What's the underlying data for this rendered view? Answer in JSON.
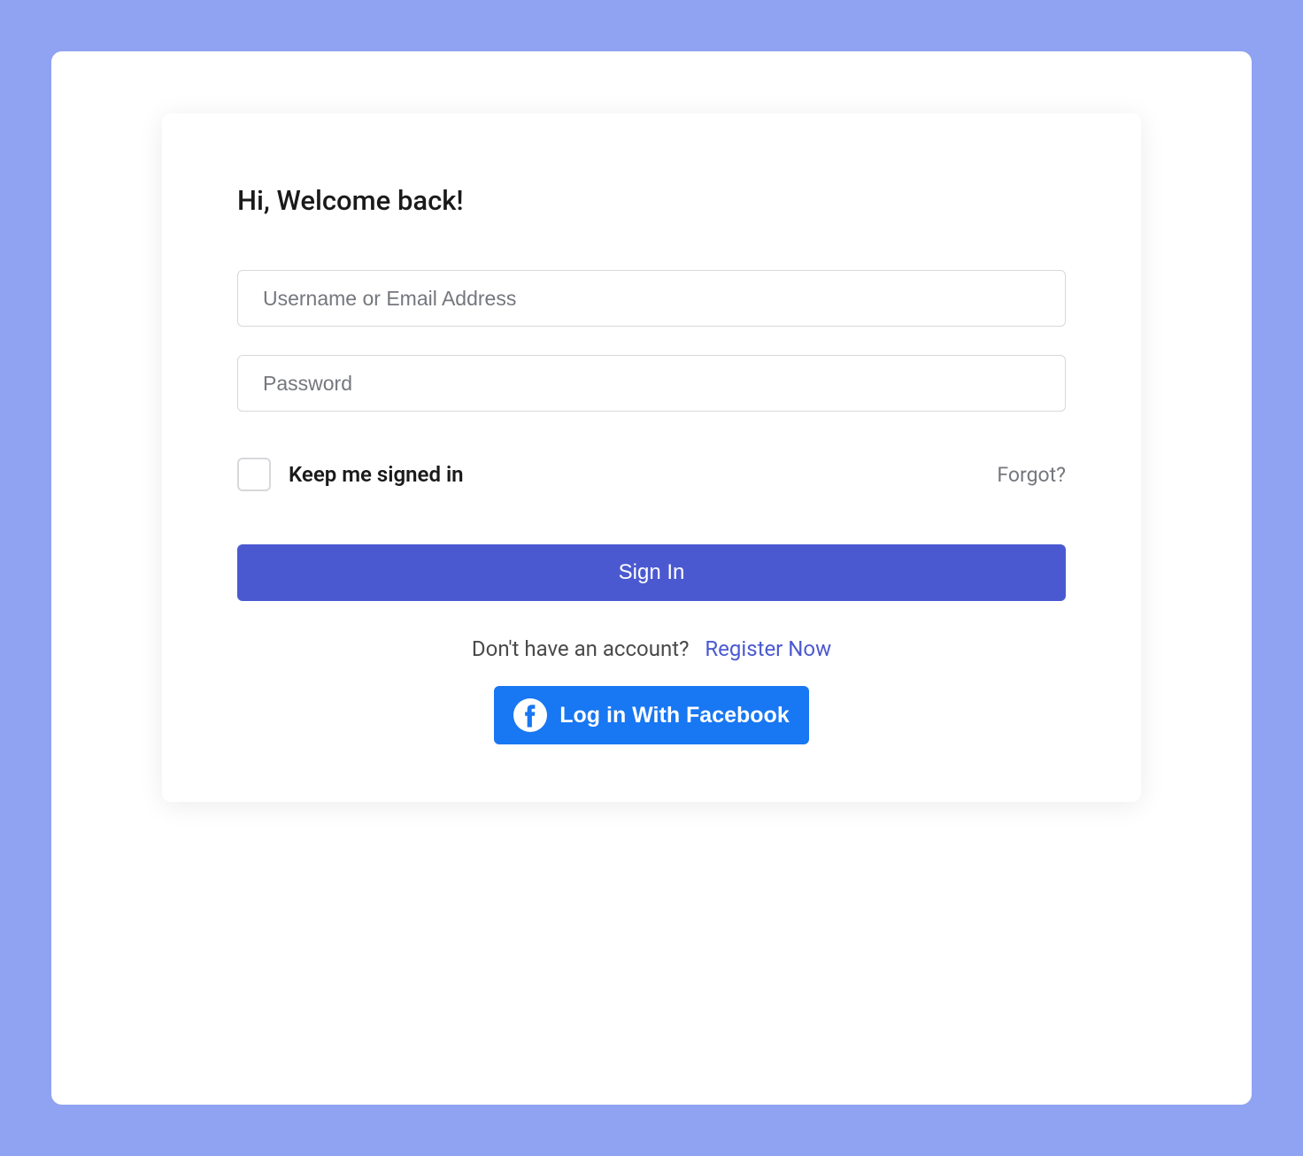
{
  "heading": "Hi, Welcome back!",
  "form": {
    "username_placeholder": "Username or Email Address",
    "password_placeholder": "Password",
    "keep_signed_label": "Keep me signed in",
    "forgot_label": "Forgot?",
    "signin_label": "Sign In"
  },
  "register": {
    "prompt": "Don't have an account?",
    "link_label": "Register Now"
  },
  "social": {
    "facebook_label": "Log in With Facebook"
  }
}
